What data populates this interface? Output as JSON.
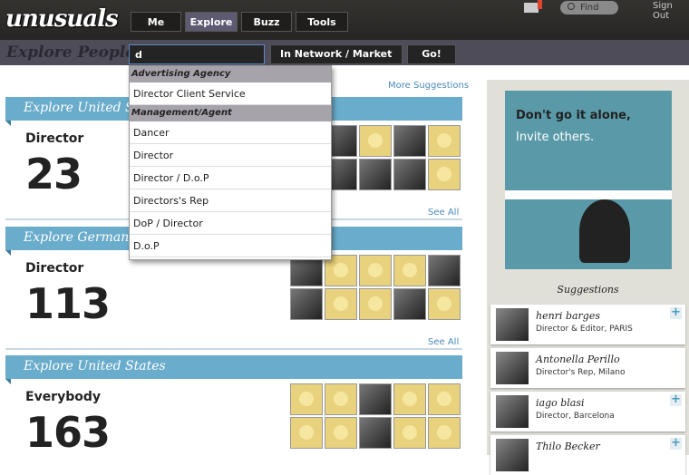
{
  "header": {
    "logo": "unusuals",
    "nav": [
      "Me",
      "Explore",
      "Buzz",
      "Tools"
    ],
    "active_nav": "Explore",
    "find_placeholder": "Find",
    "sign_out": "Sign Out"
  },
  "subbar": {
    "title": "Explore People",
    "search_value": "d",
    "network_select": "In Network / Market",
    "go": "Go!"
  },
  "more_suggestions": "More Suggestions",
  "dropdown": {
    "groups": [
      {
        "label": "Advertising Agency",
        "items": [
          "Director Client Service"
        ]
      },
      {
        "label": "Management/Agent",
        "items": [
          "Dancer",
          "Director",
          "Director / D.o.P",
          "Directors's Rep",
          "DoP / Director",
          "D.o.P"
        ]
      }
    ]
  },
  "sections": [
    {
      "header": "Explore United States",
      "role": "Director",
      "count": "23",
      "see_all": "See All",
      "cells": [
        "photo",
        "photo",
        "duck",
        "photo",
        "duck",
        "photo",
        "photo",
        "photo",
        "photo",
        "duck"
      ]
    },
    {
      "header": "Explore Germany",
      "role": "Director",
      "count": "113",
      "see_all": "See All",
      "cells": [
        "photo",
        "duck",
        "duck",
        "duck",
        "photo",
        "photo",
        "duck",
        "duck",
        "photo",
        "duck"
      ]
    },
    {
      "header": "Explore United States",
      "role": "Everybody",
      "count": "163",
      "cells": [
        "duck",
        "duck",
        "photo",
        "duck",
        "duck",
        "duck",
        "duck",
        "photo",
        "duck",
        "duck"
      ]
    }
  ],
  "sidebar": {
    "ad": {
      "line1": "Don't go it alone,",
      "line2": "Invite others."
    },
    "suggestions_title": "Suggestions",
    "suggestions": [
      {
        "name": "henri barges",
        "desc": "Director & Editor, PARIS",
        "add": "+"
      },
      {
        "name": "Antonella Perillo",
        "desc": "Director's Rep, Milano",
        "add": ""
      },
      {
        "name": "iago blasi",
        "desc": "Director, Barcelona",
        "add": "+"
      },
      {
        "name": "Thilo Becker",
        "desc": "",
        "add": "+"
      }
    ]
  },
  "colors": {
    "accent": "#6aaccb",
    "subbar": "#4f4c5a",
    "link": "#4a8ab8"
  }
}
